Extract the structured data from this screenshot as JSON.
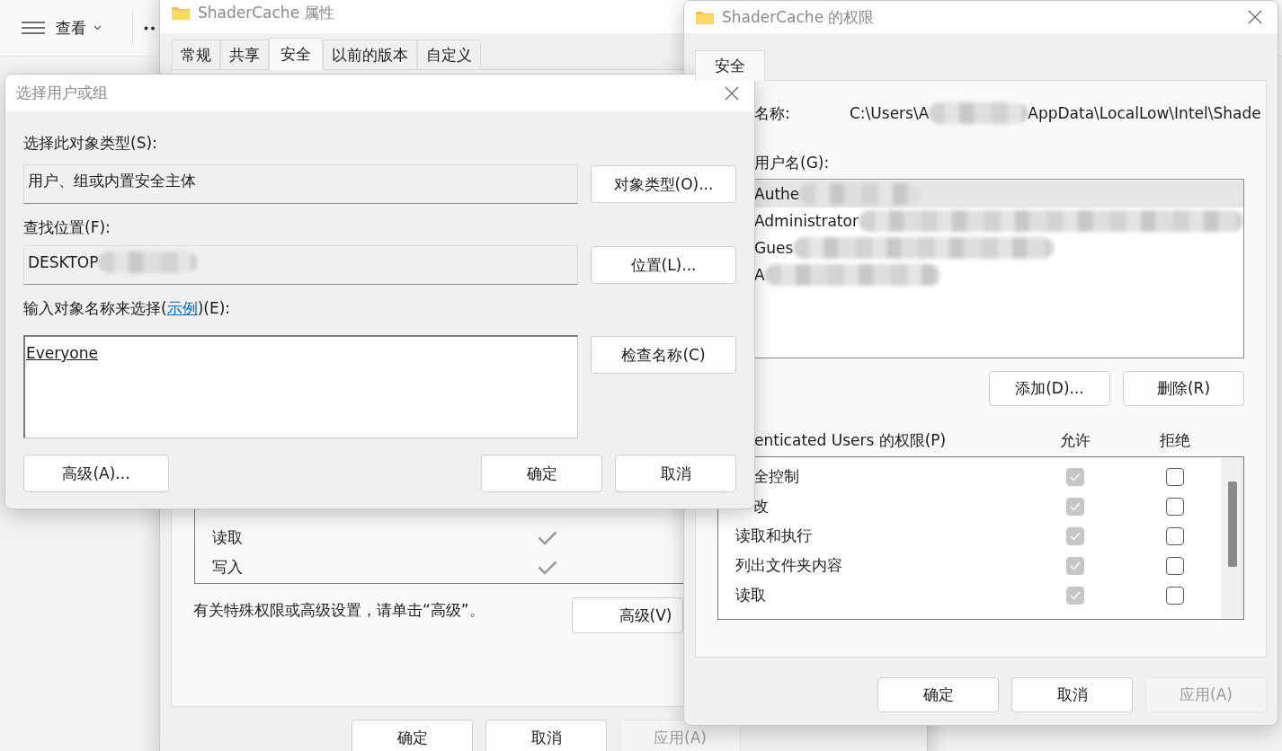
{
  "explorer": {
    "menu": "查看"
  },
  "properties_window": {
    "title": "ShaderCache 属性",
    "tabs": [
      {
        "label": "常规",
        "selected": false
      },
      {
        "label": "共享",
        "selected": false
      },
      {
        "label": "安全",
        "selected": true
      },
      {
        "label": "以前的版本",
        "selected": false
      },
      {
        "label": "自定义",
        "selected": false
      }
    ],
    "permissions": [
      {
        "label": "读取",
        "allow": true
      },
      {
        "label": "写入",
        "allow": true
      }
    ],
    "advanced_hint": "有关特殊权限或高级设置，请单击“高级”。",
    "advanced_button": "高级(V)",
    "buttons": [
      {
        "label": "确定",
        "disabled": false
      },
      {
        "label": "取消",
        "disabled": false
      },
      {
        "label": "应用(A)",
        "disabled": true
      }
    ]
  },
  "permissions_window": {
    "title": "ShaderCache 的权限",
    "tabs": [
      {
        "label": "安全",
        "selected": true
      }
    ],
    "object_name_label": "名称:",
    "path_start": "C:\\Users\\A",
    "path_end": "AppData\\LocalLow\\Intel\\Shade",
    "users_label": "用户名(G):",
    "users": [
      {
        "name": "Authe",
        "selected": true
      },
      {
        "name": "Administrator",
        "selected": false
      },
      {
        "name": "Gues",
        "selected": false
      },
      {
        "name": "A",
        "selected": false
      }
    ],
    "add_button": "添加(D)...",
    "remove_button": "删除(R)",
    "permissions_label": "enticated Users 的权限(P)",
    "allow_header": "允许",
    "deny_header": "拒绝",
    "permissions": [
      {
        "label": "全控制",
        "kind": "overlapped",
        "allow": {
          "checked": true,
          "disabled": true
        },
        "deny": {
          "checked": false,
          "disabled": false
        }
      },
      {
        "label": "改",
        "kind": "overlapped",
        "allow": {
          "checked": true,
          "disabled": true
        },
        "deny": {
          "checked": false,
          "disabled": false
        }
      },
      {
        "label": "读取和执行",
        "kind": "plain",
        "allow": {
          "checked": true,
          "disabled": true
        },
        "deny": {
          "checked": false,
          "disabled": false
        }
      },
      {
        "label": "列出文件夹内容",
        "kind": "plain",
        "allow": {
          "checked": true,
          "disabled": true
        },
        "deny": {
          "checked": false,
          "disabled": false
        }
      },
      {
        "label": "读取",
        "kind": "plain",
        "allow": {
          "checked": true,
          "disabled": true
        },
        "deny": {
          "checked": false,
          "disabled": false
        }
      }
    ],
    "buttons": [
      {
        "label": "确定",
        "disabled": false
      },
      {
        "label": "取消",
        "disabled": false
      },
      {
        "label": "应用(A)",
        "disabled": true
      }
    ]
  },
  "select_dialog": {
    "title": "选择用户或组",
    "object_type_label": "选择此对象类型(S):",
    "object_type_value": "用户、组或内置安全主体",
    "object_type_button": "对象类型(O)...",
    "location_label": "查找位置(F):",
    "location_value": "DESKTOP",
    "location_button": "位置(L)...",
    "names_label_before": "输入对象名称来选择(",
    "names_label_link": "示例",
    "names_label_after": ")(E):",
    "names_value": "Everyone",
    "check_names_button": "检查名称(C)",
    "advanced_button": "高级(A)...",
    "ok_button": "确定",
    "cancel_button": "取消"
  }
}
